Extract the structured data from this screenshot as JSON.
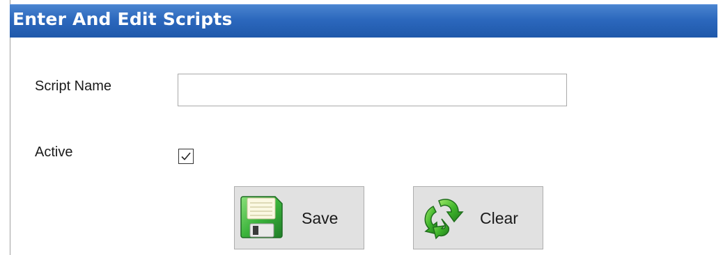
{
  "window": {
    "title": "Enter And Edit Scripts"
  },
  "form": {
    "script_name_label": "Script Name",
    "script_name_value": "",
    "active_label": "Active",
    "active_checked": true
  },
  "buttons": {
    "save_label": "Save",
    "save_icon": "floppy-disk-icon",
    "clear_label": "Clear",
    "clear_icon": "recycle-arrows-icon"
  },
  "colors": {
    "titlebar": "#2c68bd",
    "title_text": "#ffffff",
    "button_face": "#e1e1e1",
    "icon_green": "#3cb43c"
  }
}
